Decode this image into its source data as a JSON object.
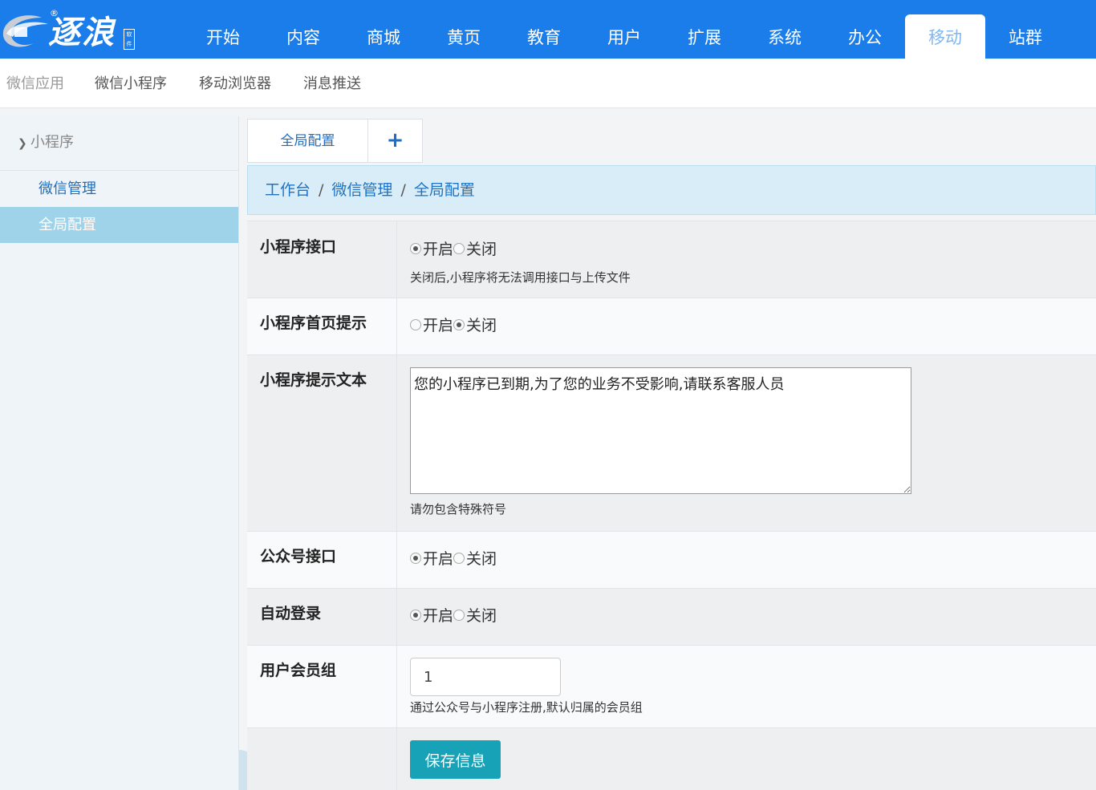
{
  "brand": {
    "logo_text": "逐浪",
    "reg_mark": "®",
    "seal_text": "软件",
    "colors": {
      "primary": "#1b7de9",
      "accent": "#17a2b8",
      "link": "#1d6fc4"
    }
  },
  "nav": {
    "items": [
      {
        "label": "开始"
      },
      {
        "label": "内容"
      },
      {
        "label": "商城"
      },
      {
        "label": "黄页"
      },
      {
        "label": "教育"
      },
      {
        "label": "用户"
      },
      {
        "label": "扩展"
      },
      {
        "label": "系统"
      },
      {
        "label": "办公"
      },
      {
        "label": "移动"
      },
      {
        "label": "站群"
      }
    ],
    "active": "移动"
  },
  "subnav": {
    "items": [
      {
        "label": "微信应用"
      },
      {
        "label": "微信小程序"
      },
      {
        "label": "移动浏览器"
      },
      {
        "label": "消息推送"
      }
    ]
  },
  "sidebar": {
    "group": "小程序",
    "items": [
      {
        "label": "微信管理"
      },
      {
        "label": "全局配置"
      }
    ]
  },
  "tabs": {
    "items": [
      {
        "label": "全局配置"
      }
    ],
    "add_icon": "plus-icon",
    "add_label": "+"
  },
  "breadcrumb": {
    "items": [
      "工作台",
      "微信管理",
      "全局配置"
    ],
    "separator": "/"
  },
  "form": {
    "miniapp_api": {
      "label": "小程序接口",
      "options": [
        "开启",
        "关闭"
      ],
      "selected": "开启",
      "hint": "关闭后,小程序将无法调用接口与上传文件"
    },
    "miniapp_home_tip": {
      "label": "小程序首页提示",
      "options": [
        "开启",
        "关闭"
      ],
      "selected": "关闭"
    },
    "miniapp_tip_text": {
      "label": "小程序提示文本",
      "value": "您的小程序已到期,为了您的业务不受影响,请联系客服人员",
      "hint": "请勿包含特殊符号"
    },
    "mp_api": {
      "label": "公众号接口",
      "options": [
        "开启",
        "关闭"
      ],
      "selected": "开启"
    },
    "auto_login": {
      "label": "自动登录",
      "options": [
        "开启",
        "关闭"
      ],
      "selected": "开启"
    },
    "member_group": {
      "label": "用户会员组",
      "value": "1",
      "hint": "通过公众号与小程序注册,默认归属的会员组"
    },
    "save_label": "保存信息"
  }
}
